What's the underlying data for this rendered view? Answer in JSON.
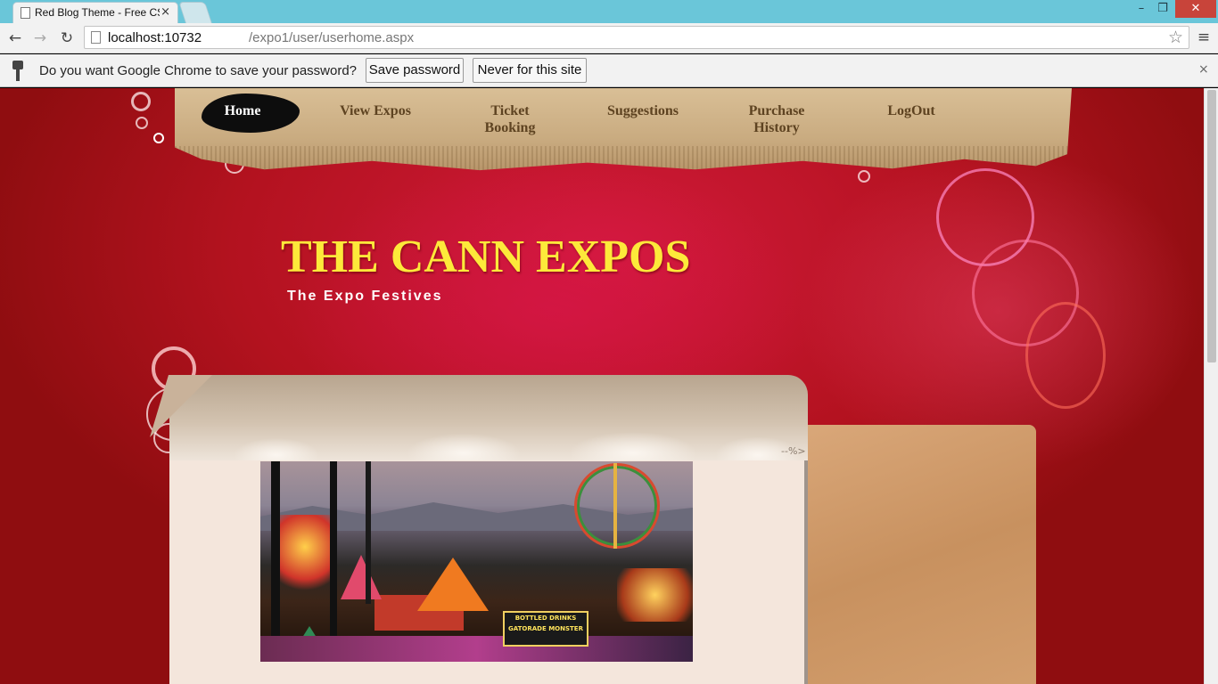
{
  "browser": {
    "tab_title": "Red Blog Theme - Free CS",
    "tab_close": "×",
    "url_host": "localhost:10732",
    "url_path": "/expo1/user/userhome.aspx",
    "window_controls": {
      "minimize": "–",
      "maximize": "❐",
      "close": "✕"
    },
    "nav": {
      "back": "←",
      "forward": "→",
      "reload": "↻"
    },
    "star": "☆",
    "menu": "≡"
  },
  "infobar": {
    "message": "Do you want Google Chrome to save your password?",
    "save_button": "Save password",
    "never_button": "Never for this site",
    "close": "×"
  },
  "site": {
    "nav": {
      "home": "Home",
      "view_expos": "View Expos",
      "ticket_booking": "Ticket Booking",
      "suggestions": "Suggestions",
      "purchase_history": "Purchase History",
      "logout": "LogOut"
    },
    "title": "THE CANN EXPOS",
    "tagline": "The Expo Festives",
    "comment_marker": "--%>",
    "photo_sign": [
      "BOTTLED DRINKS",
      "GATORADE MONSTER"
    ]
  },
  "colors": {
    "page_red": "#b3121f",
    "title_yellow": "#fde93a",
    "nav_text": "#5e4321",
    "chrome_frame": "#6ac6d9",
    "close_red": "#c8443a"
  },
  "icons": [
    "page-icon",
    "star-icon",
    "key-icon",
    "menu-icon",
    "close-icon",
    "back-icon",
    "forward-icon",
    "reload-icon"
  ]
}
